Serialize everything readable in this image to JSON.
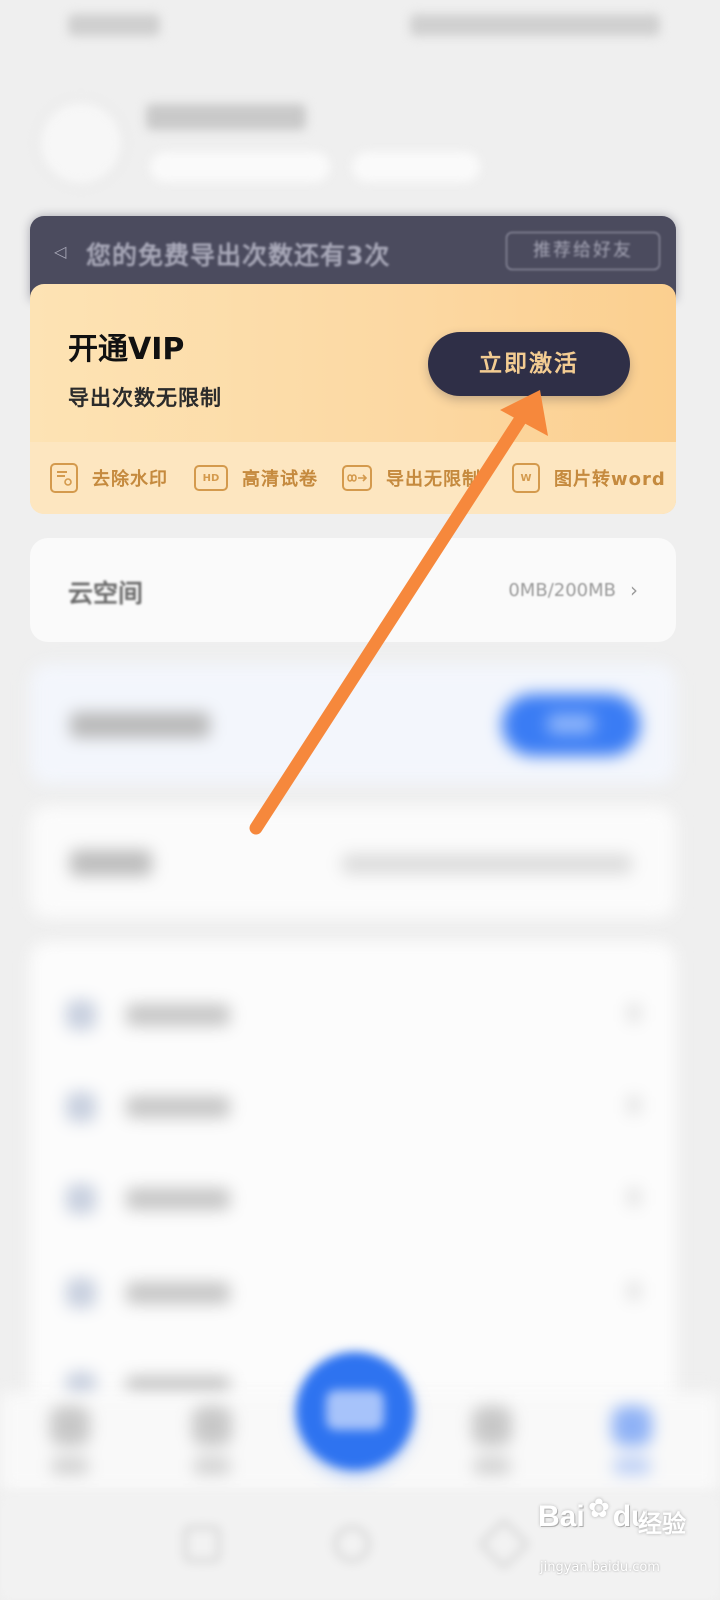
{
  "notice": {
    "message": "您的免费导出次数还有3次",
    "recommend_label": "推荐给好友"
  },
  "vip": {
    "title": "开通VIP",
    "subtitle": "导出次数无限制",
    "activate_label": "立即激活",
    "features": [
      {
        "icon": "remove-watermark-icon",
        "label": "去除水印"
      },
      {
        "icon": "hd-icon",
        "icon_text": "HD",
        "label": "高清试卷"
      },
      {
        "icon": "infinite-export-icon",
        "label": "导出无限制"
      },
      {
        "icon": "word-icon",
        "icon_text": "W",
        "label": "图片转word"
      }
    ]
  },
  "cloud": {
    "label": "云空间",
    "value": "0MB/200MB"
  },
  "watermark": {
    "logo": "Bai",
    "logo2": "du",
    "cn": "经验",
    "url": "jingyan.baidu.com"
  },
  "colors": {
    "accent_blue": "#2e73f0",
    "vip_button": "#2f2f47",
    "vip_gold": "#c58a3e",
    "annotation_arrow": "#f6883c"
  }
}
